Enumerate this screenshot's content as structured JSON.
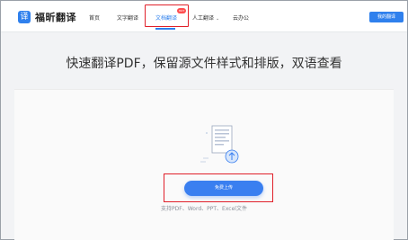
{
  "brand": {
    "logo_glyph": "译",
    "name": "福昕翻译",
    "accent": "#2f80ed"
  },
  "nav": {
    "items": [
      {
        "label": "首页"
      },
      {
        "label": "文字翻译"
      },
      {
        "label": "文档翻译",
        "badge": "HOT",
        "active": true
      },
      {
        "label": "人工翻译",
        "has_dropdown": true
      },
      {
        "label": "云办公"
      }
    ],
    "login_label": "我的翻译"
  },
  "main": {
    "headline": "快速翻译PDF，保留源文件样式和排版，双语查看",
    "upload_label": "免费上传",
    "support_text": "支持PDF、Word、PPT、Excel文件"
  },
  "annotations": {
    "highlight_color": "#e0202a"
  }
}
